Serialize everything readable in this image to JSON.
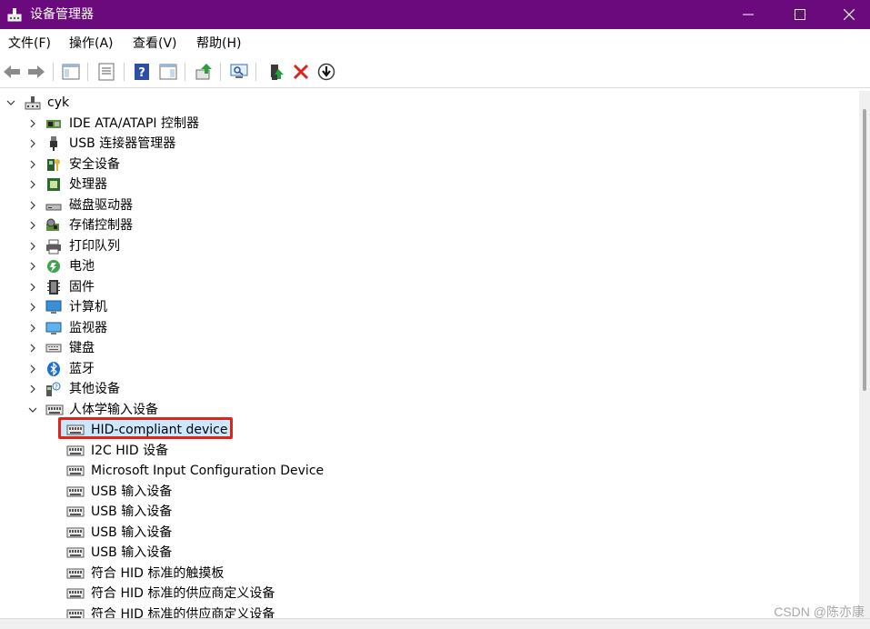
{
  "window": {
    "title": "设备管理器"
  },
  "menu": [
    "文件(F)",
    "操作(A)",
    "查看(V)",
    "帮助(H)"
  ],
  "tree": {
    "root": "cyk",
    "categories": [
      {
        "label": "IDE ATA/ATAPI 控制器",
        "icon": "ide-controller-icon"
      },
      {
        "label": "USB 连接器管理器",
        "icon": "usb-connector-icon"
      },
      {
        "label": "安全设备",
        "icon": "security-device-icon"
      },
      {
        "label": "处理器",
        "icon": "processor-icon"
      },
      {
        "label": "磁盘驱动器",
        "icon": "disk-drive-icon"
      },
      {
        "label": "存储控制器",
        "icon": "storage-controller-icon"
      },
      {
        "label": "打印队列",
        "icon": "printer-icon"
      },
      {
        "label": "电池",
        "icon": "battery-icon"
      },
      {
        "label": "固件",
        "icon": "firmware-icon"
      },
      {
        "label": "计算机",
        "icon": "computer-icon"
      },
      {
        "label": "监视器",
        "icon": "monitor-icon"
      },
      {
        "label": "键盘",
        "icon": "keyboard-icon"
      },
      {
        "label": "蓝牙",
        "icon": "bluetooth-icon"
      },
      {
        "label": "其他设备",
        "icon": "other-device-icon"
      },
      {
        "label": "人体学输入设备",
        "icon": "hid-icon",
        "expanded": true
      }
    ],
    "hid_children": [
      {
        "label": "HID-compliant device",
        "selected": true
      },
      {
        "label": "I2C HID 设备"
      },
      {
        "label": "Microsoft Input Configuration Device"
      },
      {
        "label": "USB 输入设备"
      },
      {
        "label": "USB 输入设备"
      },
      {
        "label": "USB 输入设备"
      },
      {
        "label": "USB 输入设备"
      },
      {
        "label": "符合 HID 标准的触摸板"
      },
      {
        "label": "符合 HID 标准的供应商定义设备"
      },
      {
        "label": "符合 HID 标准的供应商定义设备"
      }
    ]
  },
  "watermark": "CSDN @陈亦康",
  "colors": {
    "titlebar": "#6b0a7d",
    "selection": "#cce8ff",
    "highlight_border": "#e0241c"
  }
}
